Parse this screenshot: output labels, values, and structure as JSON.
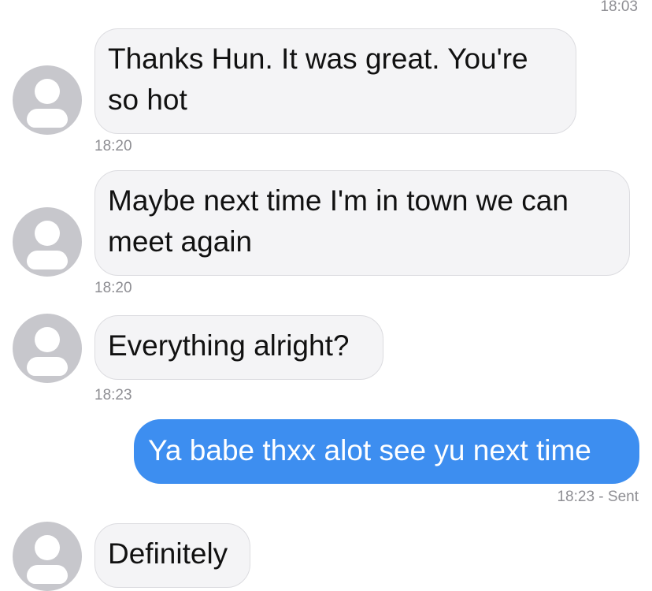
{
  "status_time": "18:03",
  "messages": [
    {
      "direction": "incoming",
      "text": "Thanks Hun. It was great. You're so hot",
      "time": "18:20",
      "avatar_icon": "person-placeholder-icon"
    },
    {
      "direction": "incoming",
      "text": "Maybe next time I'm in town we can meet again",
      "time": "18:20",
      "avatar_icon": "person-placeholder-icon"
    },
    {
      "direction": "incoming",
      "text": "Everything alright?",
      "time": "18:23",
      "avatar_icon": "person-placeholder-icon"
    },
    {
      "direction": "outgoing",
      "text": "Ya babe thxx alot see yu next time",
      "time": "18:23 - Sent"
    },
    {
      "direction": "incoming",
      "text": "Definitely",
      "time": "",
      "avatar_icon": "person-placeholder-icon"
    }
  ],
  "colors": {
    "incoming_bubble": "#f4f4f6",
    "outgoing_bubble": "#3d8ef0",
    "avatar": "#c7c7cc",
    "timestamp": "#8e8e93"
  }
}
